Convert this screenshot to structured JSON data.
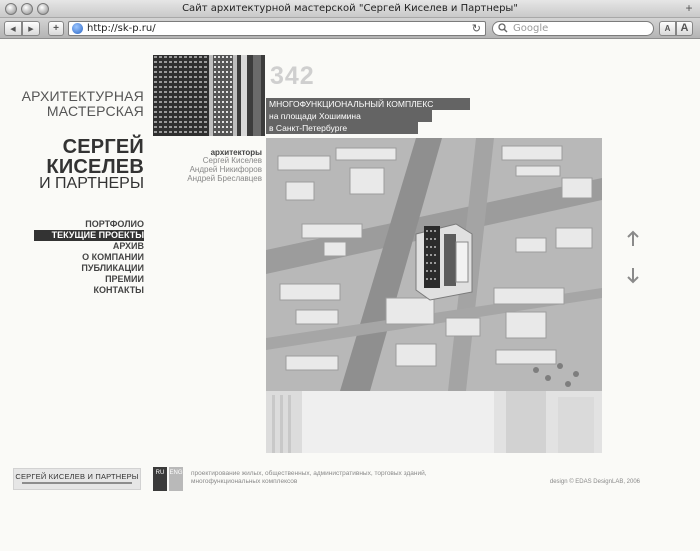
{
  "window": {
    "title": "Сайт архитектурной мастерской \"Сергей Киселев и Партнеры\""
  },
  "toolbar": {
    "url": "http://sk-p.ru/",
    "search_placeholder": "Google",
    "back_symbol": "◀",
    "forward_symbol": "▶",
    "add_symbol": "+",
    "reload_symbol": "↻",
    "text_smaller": "A",
    "text_larger": "A"
  },
  "brand": {
    "line1": "АРХИТЕКТУРНАЯ",
    "line2": "МАСТЕРСКАЯ",
    "line3": "СЕРГЕЙ",
    "line4": "КИСЕЛЕВ",
    "line5": "И ПАРТНЕРЫ"
  },
  "nav": {
    "items": [
      {
        "label": "ПОРТФОЛИО",
        "active": false
      },
      {
        "label": "ТЕКУЩИЕ ПРОЕКТЫ",
        "active": true
      },
      {
        "label": "АРХИВ",
        "active": false
      },
      {
        "label": "О КОМПАНИИ",
        "active": false
      },
      {
        "label": "ПУБЛИКАЦИИ",
        "active": false
      },
      {
        "label": "ПРЕМИИ",
        "active": false
      },
      {
        "label": "КОНТАКТЫ",
        "active": false
      }
    ]
  },
  "project": {
    "number": "342",
    "title_line1": "МНОГОФУНКЦИОНАЛЬНЫЙ КОМПЛЕКС",
    "title_line2": "на площади Хошимина",
    "title_line3": "в Санкт-Петербурге",
    "architects_label": "архитекторы",
    "architects": [
      "Сергей Киселев",
      "Андрей Никифоров",
      "Андрей Бреславцев"
    ]
  },
  "footer": {
    "logo_text": "СЕРГЕЙ КИСЕЛЕВ И ПАРТНЕРЫ",
    "lang_ru": "RU",
    "lang_eng": "ENG",
    "description_line1": "проектирование жилых, общественных, административных, торговых зданий,",
    "description_line2": "многофункциональных комплексов",
    "credit": "design © EDAS DesignLAB, 2006"
  },
  "colors": {
    "page_bg": "#fafaf7",
    "banner": "#646464",
    "nav_active_bg": "#333333",
    "lang_ru_bg": "#3a3a3a",
    "lang_eng_bg": "#b9b9b9"
  }
}
